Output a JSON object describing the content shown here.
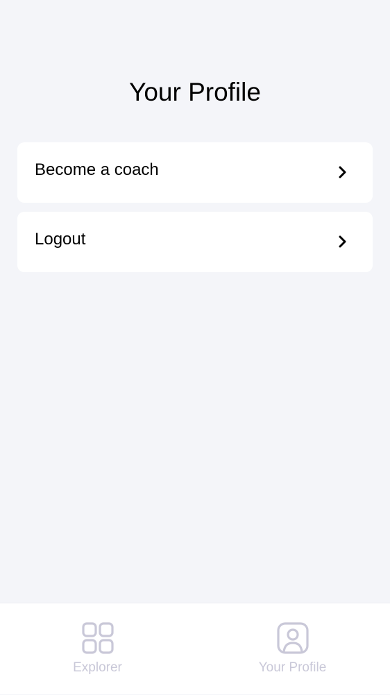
{
  "header": {
    "title": "Your Profile"
  },
  "menu": {
    "items": [
      {
        "label": "Become a coach",
        "icon": "chevron-right-icon"
      },
      {
        "label": "Logout",
        "icon": "chevron-right-icon"
      }
    ]
  },
  "bottom_nav": {
    "items": [
      {
        "label": "Explorer",
        "icon": "grid-icon"
      },
      {
        "label": "Your Profile",
        "icon": "profile-icon"
      }
    ]
  },
  "colors": {
    "background": "#F4F5F9",
    "card": "#FFFFFF",
    "nav_inactive": "#C9C8D8"
  }
}
